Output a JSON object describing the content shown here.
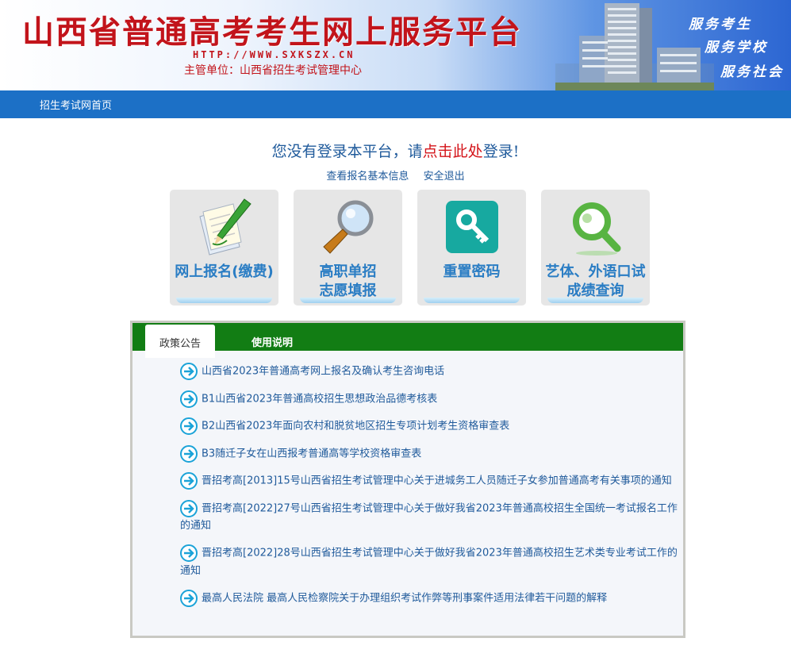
{
  "header": {
    "title": "山西省普通高考考生网上服务平台",
    "url": "HTTP://WWW.SXKSZX.CN",
    "owner": "主管单位：山西省招生考试管理中心",
    "slogans": [
      "服务考生",
      "服务学校",
      "服务社会"
    ]
  },
  "nav": {
    "home_label": "招生考试网首页"
  },
  "login": {
    "prefix": "您没有登录本平台，请",
    "link_text": "点击此处",
    "suffix": "登录!",
    "view_info": "查看报名基本信息",
    "logout": "安全退出"
  },
  "cards": [
    {
      "line1": "网上报名(缴费)",
      "line2": "",
      "icon": "pen-paper-icon"
    },
    {
      "line1": "高职单招",
      "line2": "志愿填报",
      "icon": "magnifier-icon"
    },
    {
      "line1": "重置密码",
      "line2": "",
      "icon": "key-icon"
    },
    {
      "line1": "艺体、外语口试",
      "line2": "成绩查询",
      "icon": "search-icon"
    }
  ],
  "tabs": {
    "active": "政策公告",
    "second": "使用说明"
  },
  "announcements": [
    "山西省2023年普通高考网上报名及确认考生咨询电话",
    "B1山西省2023年普通高校招生思想政治品德考核表",
    "B2山西省2023年面向农村和脱贫地区招生专项计划考生资格审查表",
    "B3随迁子女在山西报考普通高等学校资格审查表",
    "晋招考高[2013]15号山西省招生考试管理中心关于进城务工人员随迁子女参加普通高考有关事项的通知",
    "晋招考高[2022]27号山西省招生考试管理中心关于做好我省2023年普通高校招生全国统一考试报名工作的通知",
    "晋招考高[2022]28号山西省招生考试管理中心关于做好我省2023年普通高校招生艺术类专业考试工作的通知",
    "最高人民法院 最高人民检察院关于办理组织考试作弊等刑事案件适用法律若干问题的解释"
  ],
  "colors": {
    "title_red": "#c2141b",
    "nav_blue": "#1c70c6",
    "tab_green": "#127d14",
    "link_blue": "#1f5a9b"
  }
}
